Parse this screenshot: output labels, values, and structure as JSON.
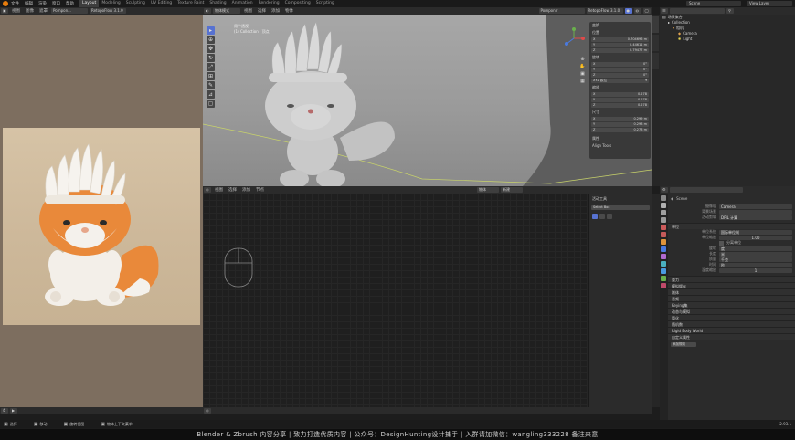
{
  "menu": [
    "文件",
    "编辑",
    "渲染",
    "窗口",
    "帮助"
  ],
  "workspaces": [
    "Layout",
    "Modeling",
    "Sculpting",
    "UV Editing",
    "Texture Paint",
    "Shading",
    "Animation",
    "Rendering",
    "Compositing",
    "Scripting"
  ],
  "active_workspace": "Layout",
  "scene_name": "Scene",
  "view_layer": "View Layer",
  "left_panel": {
    "header": [
      "视图",
      "图像",
      "遮罩"
    ],
    "image_name": "Pompon...",
    "image_selector": "RetopoFlow 3.1.0"
  },
  "viewport": {
    "mode": "物体模式",
    "menus": [
      "视图",
      "选择",
      "添加",
      "物体"
    ],
    "overlay_label1": "用户透视",
    "overlay_label2": "(1) Collection | 顶点",
    "object_name": "Pompon.r",
    "addon": "RetopoFlow 3.1.0",
    "tools": [
      "select",
      "cursor",
      "move",
      "rotate",
      "scale",
      "transform",
      "annotate",
      "measure",
      "add"
    ]
  },
  "n_panel": {
    "transform_title": "变换",
    "location_label": "位置",
    "location": [
      "0.704696 m",
      "0.44611 m",
      "0.79477 m"
    ],
    "rotation_label": "旋转",
    "rotation": [
      "0°",
      "0°",
      "0°"
    ],
    "mode": "XYZ 欧拉",
    "scale_label": "缩放",
    "scale": [
      "0.278",
      "0.278",
      "0.278"
    ],
    "dimensions_label": "尺寸",
    "dimensions": [
      "0.299 m",
      "0.298 m",
      "0.278 m"
    ],
    "properties_title": "属性",
    "align_tools": "Align Tools"
  },
  "outliner": {
    "title": "场景集合",
    "items": [
      "Collection",
      "相机",
      "Camera",
      "Light"
    ]
  },
  "node_editor": {
    "menus": [
      "视图",
      "选择",
      "添加",
      "节点"
    ],
    "mode": "物体",
    "slot": "新建",
    "side_title": "活动工具",
    "side_item": "Select Box"
  },
  "properties": {
    "scene": "Scene",
    "camera_label": "摄像机",
    "camera": "Camera",
    "bg_label": "背景场景",
    "clip_label": "活动剪辑",
    "clip": "DPIL 计算",
    "units_title": "单位",
    "unit_system_label": "单位系统",
    "unit_system": "国际单位制",
    "unit_scale_label": "单位缩放",
    "unit_scale": "1.00",
    "separate_label": "分离单位",
    "rotation_label": "旋转",
    "rotation": "度",
    "length_label": "长度",
    "length": "米",
    "mass_label": "质量",
    "mass": "千克",
    "time_label": "时间",
    "time": "秒",
    "temperature_label": "温度缩放",
    "temperature": "1",
    "panels": [
      "重力",
      "模拟缓存",
      "刚体",
      "音频",
      "Keying集",
      "动态与模拟",
      "简化",
      "随机数",
      "Rigid Body World",
      "自定义属性"
    ],
    "add_button": "添加规则"
  },
  "statusbar": [
    "选择",
    "移动",
    "旋转视图",
    "物体上下文菜单"
  ],
  "version": "2.93.1",
  "footer": "Blender  &  Zbrush 内容分享    |    致力打造优质内容    |    公众号：DesignHunting设计捕手    |    入群请加微信：wangling333228 备注来意",
  "colors": {
    "accent": "#5772d1",
    "fox_orange": "#e9893a",
    "sculpt_grey": "#c9c9c9"
  }
}
